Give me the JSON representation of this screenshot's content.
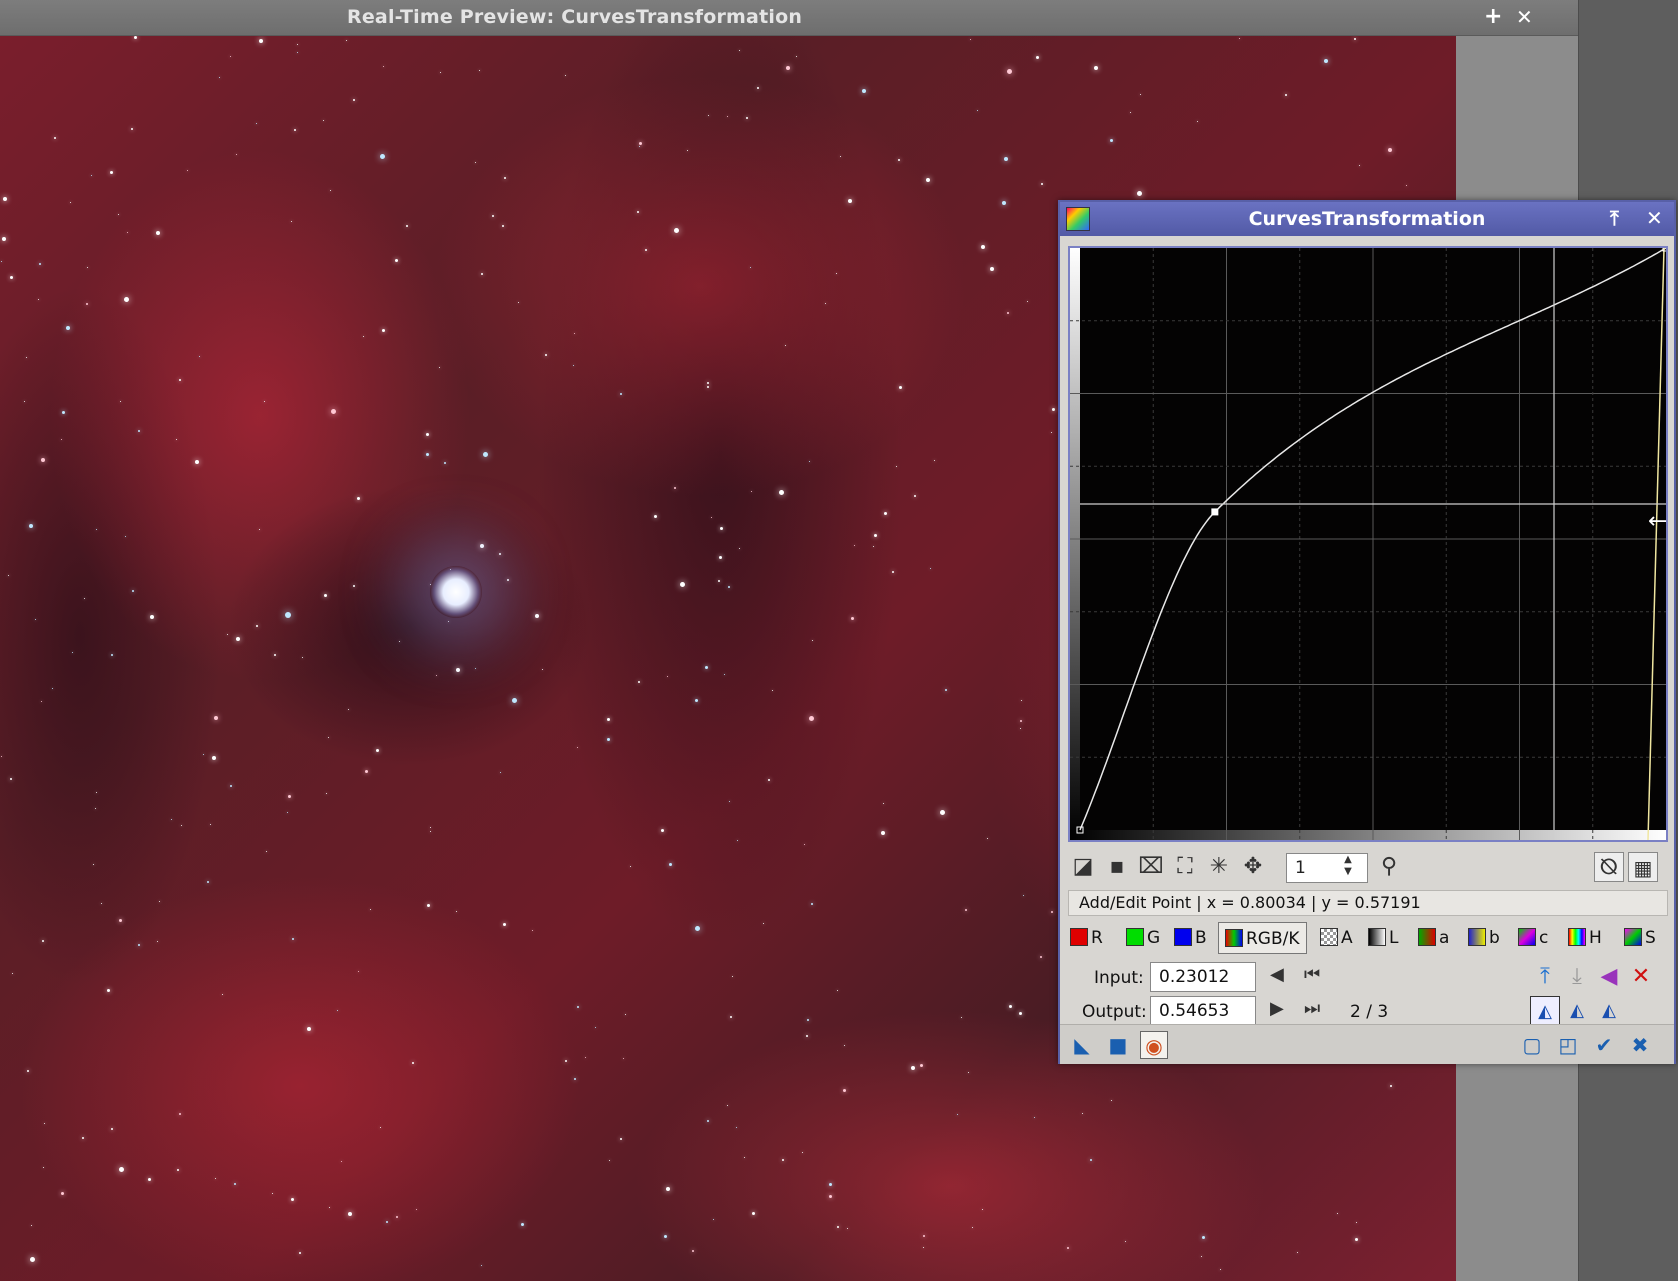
{
  "preview": {
    "title": "Real-Time Preview: CurvesTransformation",
    "add_icon": "+",
    "close_icon": "✕"
  },
  "curves": {
    "title": "CurvesTransformation",
    "shade_icon": "⤒",
    "close_icon": "✕",
    "zoom_value": "1",
    "status_text": "Add/Edit Point | x = 0.80034 | y = 0.57191",
    "channels": [
      {
        "label": "R",
        "color": "#e00000"
      },
      {
        "label": "G",
        "color": "#00dd00"
      },
      {
        "label": "B",
        "color": "#0000ee"
      },
      {
        "label": "RGB/K",
        "color": "#000000"
      },
      {
        "label": "A",
        "color": "#888888"
      },
      {
        "label": "L",
        "color": "#444444"
      },
      {
        "label": "a",
        "color": "#cc2200"
      },
      {
        "label": "b",
        "color": "#2222cc"
      },
      {
        "label": "c",
        "color": "#aa44aa"
      },
      {
        "label": "H",
        "color": "#cc4488"
      },
      {
        "label": "S",
        "color": "#dd33aa"
      }
    ],
    "active_channel": "RGB/K",
    "input_label": "Input:",
    "input_value": "0.23012",
    "output_label": "Output:",
    "output_value": "0.54653",
    "point_index": "2 / 3",
    "curve_points": [
      [
        0,
        0
      ],
      [
        0.23012,
        0.54653
      ],
      [
        1,
        1
      ]
    ],
    "cursor_readout": {
      "x": 0.80034,
      "y": 0.57191
    }
  }
}
